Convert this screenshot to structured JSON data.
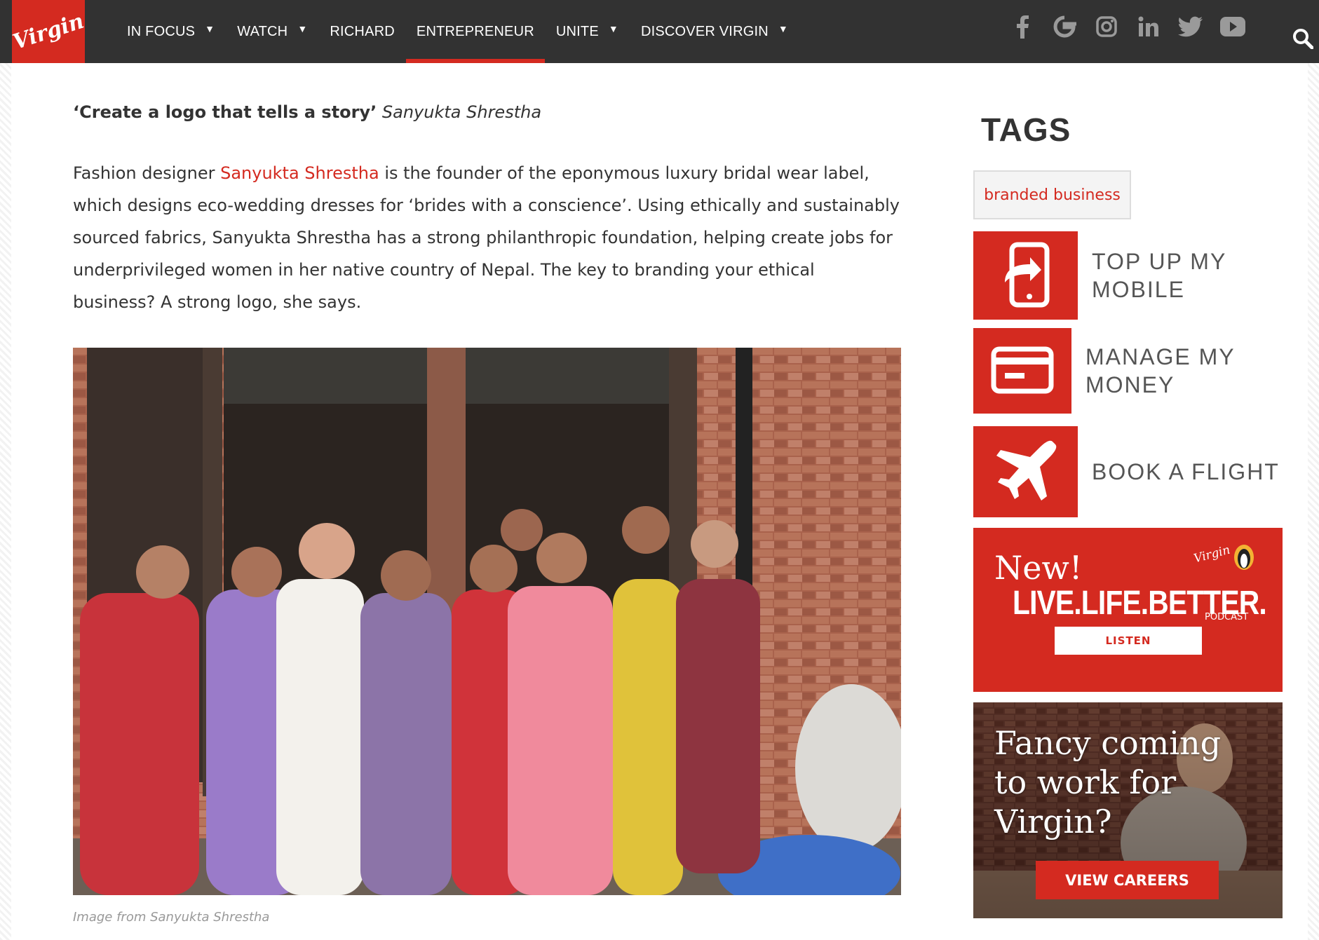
{
  "brand": {
    "logo_text": "Virgin",
    "accent": "#d42a20",
    "header_bg": "#323232"
  },
  "nav": {
    "items": [
      {
        "label": "IN FOCUS",
        "has_dropdown": true
      },
      {
        "label": "WATCH",
        "has_dropdown": true
      },
      {
        "label": "RICHARD",
        "has_dropdown": false
      },
      {
        "label": "ENTREPRENEUR",
        "has_dropdown": false,
        "active": true
      },
      {
        "label": "UNITE",
        "has_dropdown": true
      },
      {
        "label": "DISCOVER VIRGIN",
        "has_dropdown": true
      }
    ]
  },
  "socials": [
    "facebook-icon",
    "google-icon",
    "instagram-icon",
    "linkedin-icon",
    "twitter-icon",
    "youtube-icon"
  ],
  "article": {
    "quote_title": "‘Create a logo that tells a story’",
    "quote_author": "Sanyukta Shrestha",
    "para_prefix": "Fashion designer ",
    "para_link": "Sanyukta Shrestha",
    "para_rest": " is the founder of the eponymous luxury bridal wear label, which designs eco-wedding dresses for ‘brides with a conscience’. Using ethically and sustainably sourced fabrics, Sanyukta Shrestha has a strong philanthropic foundation, helping create jobs for underprivileged women in her native country of Nepal. The key to branding your ethical business? A strong logo, she says.",
    "image_caption": "Image from Sanyukta Shrestha"
  },
  "sidebar": {
    "tags_title": "TAGS",
    "tag": "branded business",
    "promos": [
      {
        "line1": "TOP UP MY",
        "line2": "MOBILE",
        "icon": "mobile-topup-icon"
      },
      {
        "line1": "MANAGE MY",
        "line2": "MONEY",
        "icon": "credit-card-icon"
      },
      {
        "line1": "BOOK A FLIGHT",
        "line2": "",
        "icon": "airplane-icon"
      }
    ],
    "podcast": {
      "new": "New!",
      "title": "LIVE.LIFE.BETTER.",
      "subtitle": "PODCAST",
      "logo": "Virgin",
      "button": "LISTEN"
    },
    "careers": {
      "headline": "Fancy coming to work for Virgin?",
      "button": "VIEW CAREERS"
    }
  }
}
